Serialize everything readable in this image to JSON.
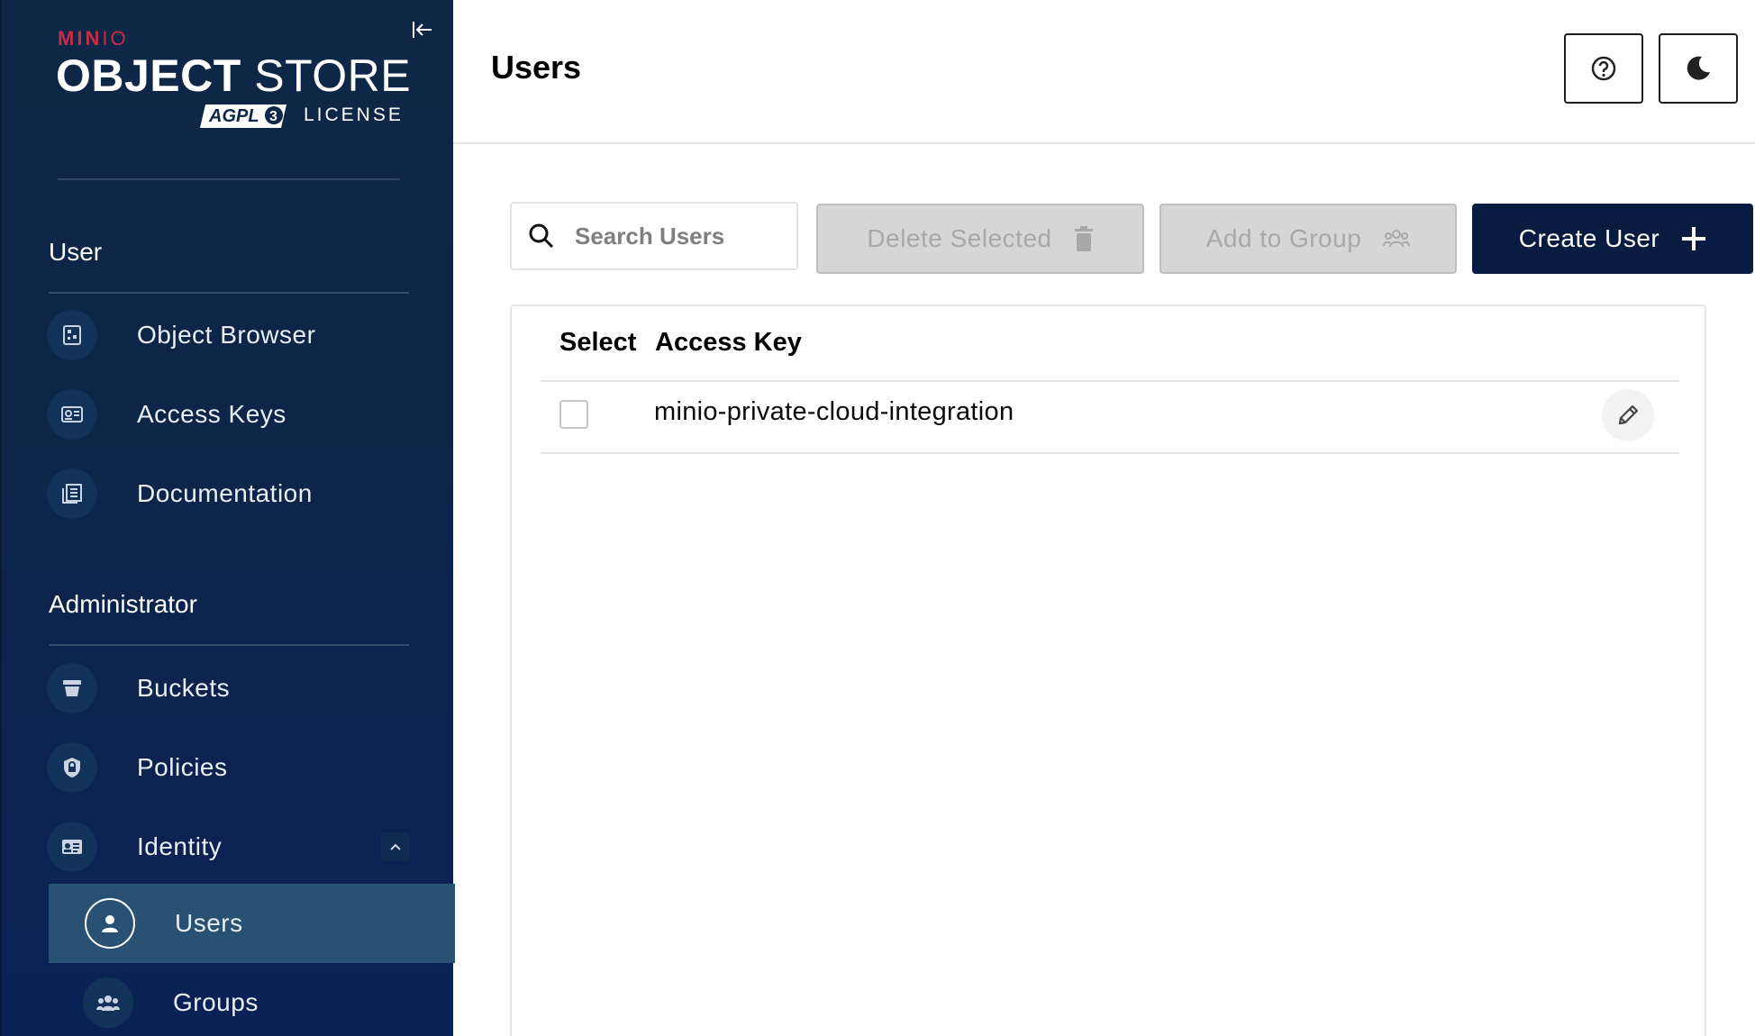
{
  "brand": {
    "minio_bold": "MIN",
    "minio_light": "IO",
    "store_bold": "OBJECT",
    "store_light": "STORE",
    "agpl": "AGPL",
    "license": "LICENSE"
  },
  "sidebar": {
    "user_section": "User",
    "user_items": [
      {
        "label": "Object Browser",
        "icon": "object-browser-icon"
      },
      {
        "label": "Access Keys",
        "icon": "access-keys-icon"
      },
      {
        "label": "Documentation",
        "icon": "documentation-icon"
      }
    ],
    "admin_section": "Administrator",
    "admin_items": [
      {
        "label": "Buckets",
        "icon": "bucket-icon"
      },
      {
        "label": "Policies",
        "icon": "policy-shield-icon"
      },
      {
        "label": "Identity",
        "icon": "identity-card-icon"
      }
    ],
    "identity_sub": [
      {
        "label": "Users",
        "icon": "user-icon",
        "active": true
      },
      {
        "label": "Groups",
        "icon": "groups-icon",
        "active": false
      }
    ]
  },
  "header": {
    "title": "Users"
  },
  "toolbar": {
    "search_placeholder": "Search Users",
    "delete_label": "Delete Selected",
    "add_group_label": "Add to Group",
    "create_label": "Create User"
  },
  "table": {
    "col_select": "Select",
    "col_access_key": "Access Key",
    "rows": [
      {
        "access_key": "minio-private-cloud-integration",
        "selected": false
      }
    ]
  },
  "colors": {
    "sidebar_bg": "#0e2747",
    "active_item": "#285174",
    "brand_red": "#c72c48",
    "primary_button": "#081c42"
  }
}
